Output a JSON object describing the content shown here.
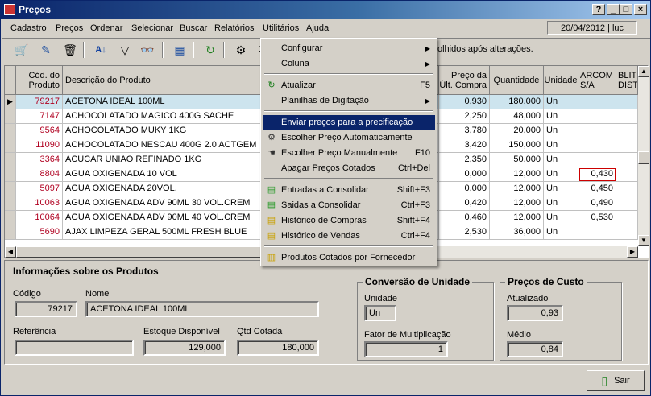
{
  "window": {
    "title": "Preços",
    "help_label": "?",
    "min_label": "_",
    "max_label": "□",
    "close_label": "×"
  },
  "menubar": {
    "items": [
      "Cadastro",
      "Preços",
      "Ordenar",
      "Selecionar",
      "Buscar",
      "Relatórios",
      "Utilitários",
      "Ajuda"
    ],
    "date_user": "20/04/2012 | luc"
  },
  "toolbar": {
    "hint": "olhidos após alterações.",
    "partial_label": "1"
  },
  "grid": {
    "headers": {
      "cod": "Cód. do Produto",
      "desc": "Descrição do Produto",
      "preco": "Preço da Últ. Compra",
      "qtd": "Quantidade",
      "unid": "Unidade",
      "arcom": "ARCOM S/A",
      "blit": "BLIT DIST"
    },
    "rows": [
      {
        "cod": "79217",
        "desc": "ACETONA IDEAL 100ML",
        "preco": "0,930",
        "qtd": "180,000",
        "unid": "Un",
        "arcom": ""
      },
      {
        "cod": "7147",
        "desc": "ACHOCOLATADO MAGICO 400G SACHE",
        "preco": "2,250",
        "qtd": "48,000",
        "unid": "Un",
        "arcom": ""
      },
      {
        "cod": "9564",
        "desc": "ACHOCOLATADO MUKY 1KG",
        "preco": "3,780",
        "qtd": "20,000",
        "unid": "Un",
        "arcom": ""
      },
      {
        "cod": "11090",
        "desc": "ACHOCOLATADO NESCAU 400G 2.0 ACTGEM",
        "preco": "3,420",
        "qtd": "150,000",
        "unid": "Un",
        "arcom": ""
      },
      {
        "cod": "3364",
        "desc": "ACUCAR UNIAO REFINADO 1KG",
        "preco": "2,350",
        "qtd": "50,000",
        "unid": "Un",
        "arcom": ""
      },
      {
        "cod": "8804",
        "desc": "AGUA OXIGENADA 10 VOL",
        "preco": "0,000",
        "qtd": "12,000",
        "unid": "Un",
        "arcom": "0,430"
      },
      {
        "cod": "5097",
        "desc": "AGUA OXIGENADA 20VOL.",
        "preco": "0,000",
        "qtd": "12,000",
        "unid": "Un",
        "arcom": "0,450"
      },
      {
        "cod": "10063",
        "desc": "AGUA OXIGENADA ADV 90ML 30 VOL.CREM",
        "preco": "0,420",
        "qtd": "12,000",
        "unid": "Un",
        "arcom": "0,490"
      },
      {
        "cod": "10064",
        "desc": "AGUA OXIGENADA ADV 90ML 40 VOL.CREM",
        "preco": "0,460",
        "qtd": "12,000",
        "unid": "Un",
        "arcom": "0,530"
      },
      {
        "cod": "5690",
        "desc": "AJAX LIMPEZA GERAL 500ML FRESH BLUE",
        "preco": "2,530",
        "qtd": "36,000",
        "unid": "Un",
        "arcom": ""
      }
    ]
  },
  "menu": {
    "items": [
      {
        "label": "Configurar",
        "shortcut": "",
        "submenu": true,
        "icon": ""
      },
      {
        "label": "Coluna",
        "shortcut": "",
        "submenu": true,
        "icon": ""
      },
      {
        "label": "Atualizar",
        "shortcut": "F5",
        "submenu": false,
        "icon": "refresh-icon"
      },
      {
        "label": "Planilhas de Digitação",
        "shortcut": "",
        "submenu": true,
        "icon": ""
      },
      {
        "label": "Enviar preços para a precificação",
        "shortcut": "",
        "submenu": false,
        "icon": ""
      },
      {
        "label": "Escolher Preço Automaticamente",
        "shortcut": "",
        "submenu": false,
        "icon": "gear-icon"
      },
      {
        "label": "Escolher Preço Manualmente",
        "shortcut": "F10",
        "submenu": false,
        "icon": "hand-icon"
      },
      {
        "label": "Apagar Preços Cotados",
        "shortcut": "Ctrl+Del",
        "submenu": false,
        "icon": ""
      },
      {
        "label": "Entradas a Consolidar",
        "shortcut": "Shift+F3",
        "submenu": false,
        "icon": "green-doc-icon"
      },
      {
        "label": "Saidas a Consolidar",
        "shortcut": "Ctrl+F3",
        "submenu": false,
        "icon": "green-doc-icon"
      },
      {
        "label": "Histórico de Compras",
        "shortcut": "Shift+F4",
        "submenu": false,
        "icon": "yellow-doc-icon"
      },
      {
        "label": "Histórico de Vendas",
        "shortcut": "Ctrl+F4",
        "submenu": false,
        "icon": "yellow-doc-icon"
      },
      {
        "label": "Produtos Cotados por Fornecedor",
        "shortcut": "",
        "submenu": false,
        "icon": "report-icon"
      }
    ]
  },
  "info": {
    "title": "Informações sobre os Produtos",
    "codigo_label": "Código",
    "codigo": "79217",
    "nome_label": "Nome",
    "nome": "ACETONA IDEAL 100ML",
    "referencia_label": "Referência",
    "referencia": "",
    "estoque_label": "Estoque Disponível",
    "estoque": "129,000",
    "qtd_label": "Qtd Cotada",
    "qtd": "180,000"
  },
  "conversao": {
    "title": "Conversão de Unidade",
    "unidade_label": "Unidade",
    "unidade": "Un",
    "fator_label": "Fator de Multiplicação",
    "fator": "1"
  },
  "custo": {
    "title": "Preços de Custo",
    "atualizado_label": "Atualizado",
    "atualizado": "0,93",
    "medio_label": "Médio",
    "medio": "0,84"
  },
  "buttons": {
    "sair": "Sair"
  }
}
